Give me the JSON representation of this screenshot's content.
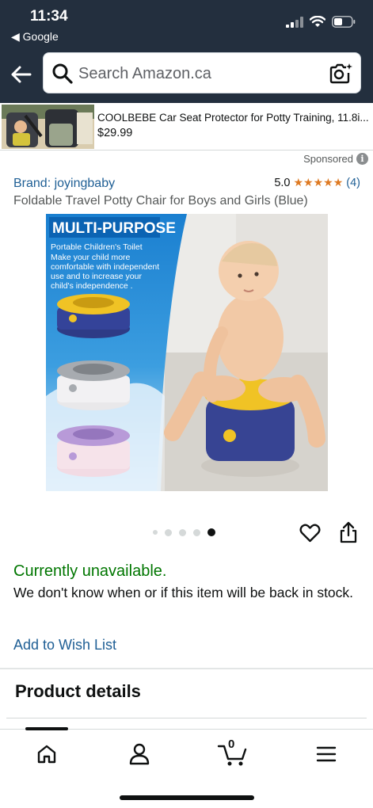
{
  "status": {
    "time": "11:34",
    "back_app": "◀ Google"
  },
  "search": {
    "placeholder": "Search Amazon.ca"
  },
  "ad": {
    "title": "COOLBEBE Car Seat Protector for Potty Training, 11.8i...",
    "price": "$29.99",
    "sponsored_label": "Sponsored",
    "info_glyph": "i"
  },
  "product": {
    "brand": "Brand: joyingbaby",
    "rating_value": "5.0",
    "stars": "★★★★★",
    "rating_count": "(4)",
    "title": "Foldable Travel Potty Chair for Boys and Girls (Blue)",
    "image_text": {
      "headline": "MULTI-PURPOSE",
      "subhead": "Portable Children's Toilet",
      "body": [
        "Make your child more",
        "comfortable with independent",
        "use and to increase your",
        "child's independence ."
      ]
    },
    "image_count": 5,
    "image_active_index": 4
  },
  "availability": {
    "status": "Currently unavailable.",
    "note": "We don't know when or if this item will be back in stock.",
    "wishlist_link": "Add to Wish List"
  },
  "details": {
    "heading": "Product details"
  },
  "nav": {
    "cart_count": "0"
  },
  "icons": [
    "back-arrow-icon",
    "search-icon",
    "camera-icon",
    "heart-icon",
    "share-icon",
    "home-icon",
    "account-icon",
    "cart-icon",
    "menu-icon",
    "info-icon"
  ],
  "colors": {
    "header_bg": "#232f3e",
    "link": "#1f5f95",
    "available_green": "#007600",
    "star_orange": "#de7921",
    "image_blue": "#1e88d4"
  }
}
